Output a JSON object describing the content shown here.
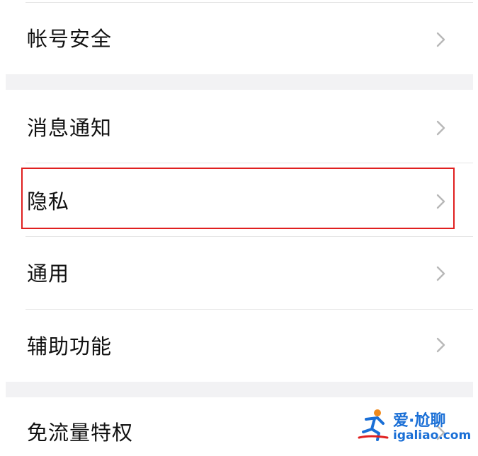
{
  "settings": {
    "rows": [
      {
        "label": "帐号安全"
      },
      {
        "label": "消息通知"
      },
      {
        "label": "隐私"
      },
      {
        "label": "通用"
      },
      {
        "label": "辅助功能"
      },
      {
        "label": "免流量特权"
      }
    ],
    "highlighted_row": "隐私"
  },
  "watermark": {
    "title": "爱·尬聊",
    "url": "igaliao.com"
  },
  "colors": {
    "background": "#ffffff",
    "separator": "#f2f2f4",
    "highlight_border": "#e02020",
    "chevron": "#b8b8b8",
    "text": "#111111",
    "watermark": "#1a6fd6"
  },
  "icons": {
    "chevron": "chevron-right-icon",
    "watermark_logo": "running-figure-logo"
  }
}
